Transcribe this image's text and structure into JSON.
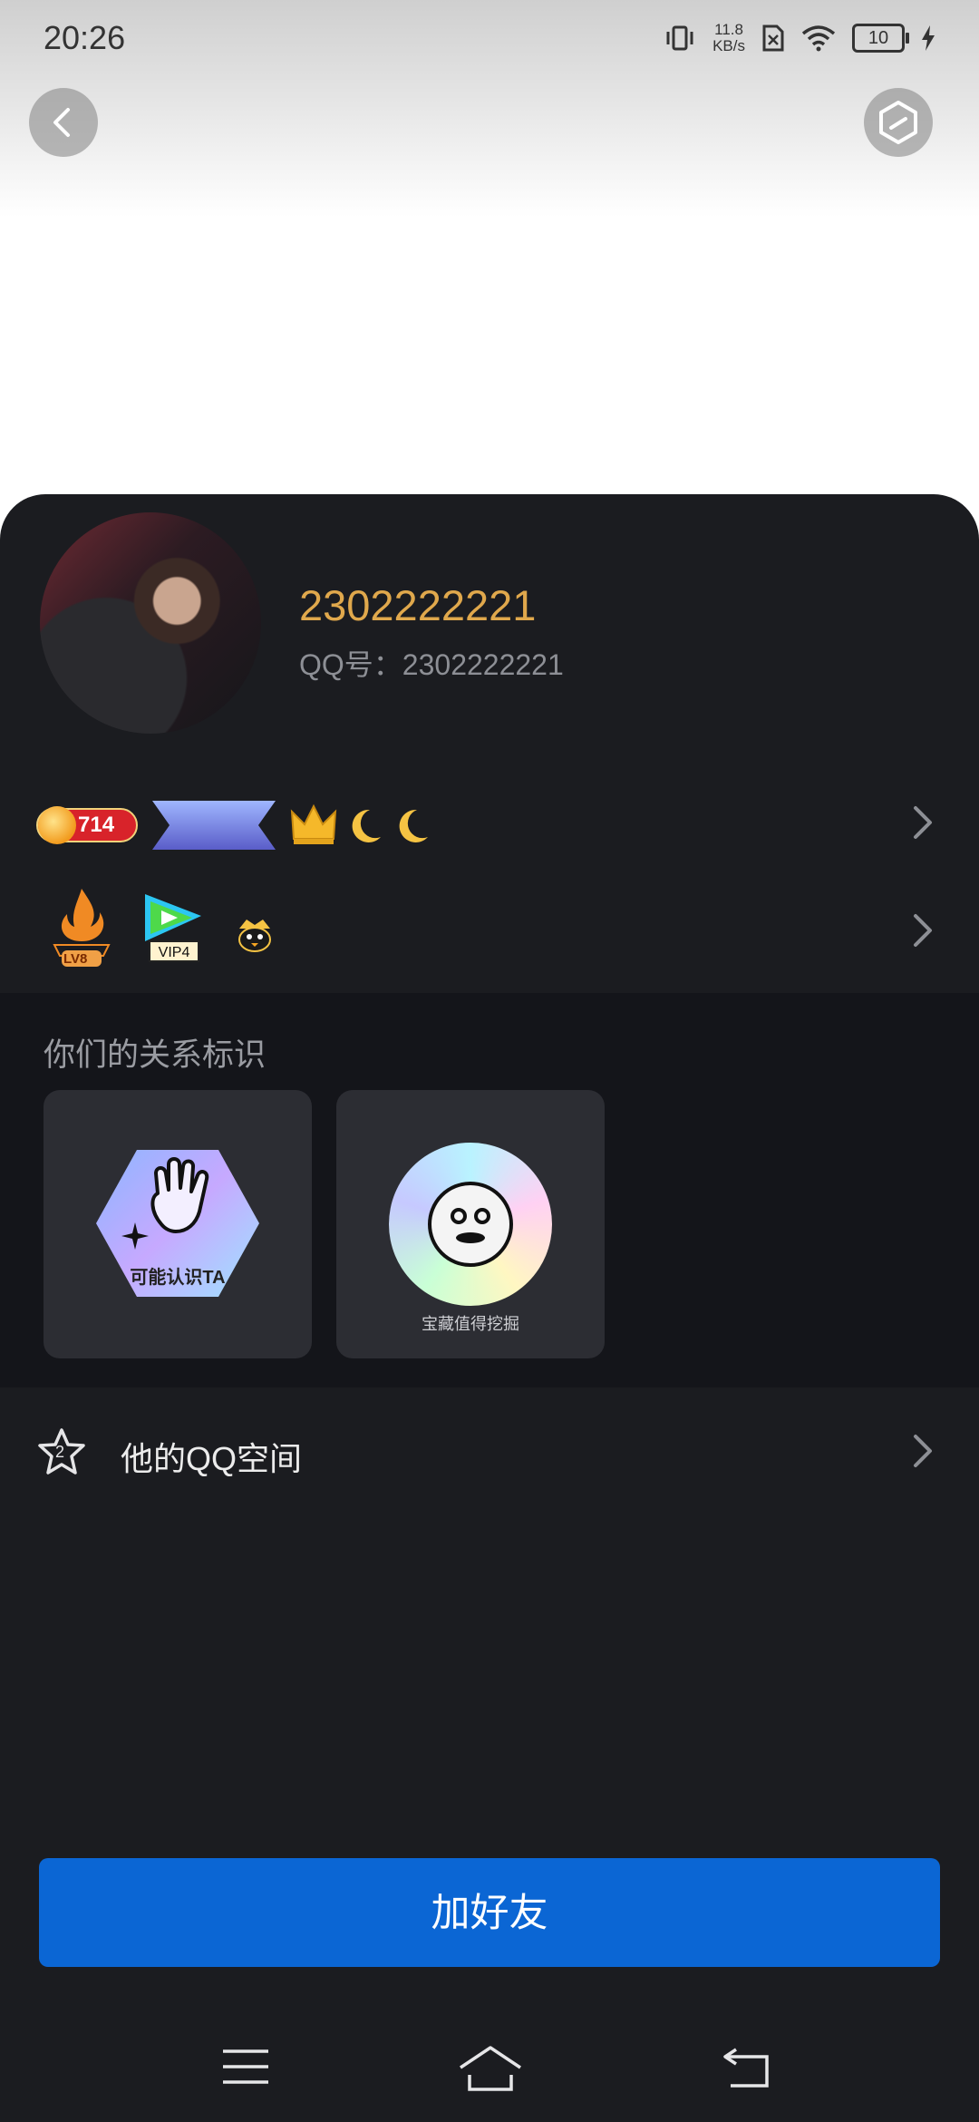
{
  "status_bar": {
    "time": "20:26",
    "net_speed_value": "11.8",
    "net_speed_unit": "KB/s",
    "battery": "10"
  },
  "profile": {
    "nickname": "2302222221",
    "qq_label": "QQ号：",
    "qq_number": "2302222221"
  },
  "badges": {
    "score": "714",
    "level_label": "LV8",
    "vip_label": "VIP4"
  },
  "relations": {
    "title": "你们的关系标识",
    "tiles": [
      {
        "label": "可能认识TA"
      },
      {
        "label": "宝藏值得挖掘"
      }
    ]
  },
  "qzone": {
    "label": "他的QQ空间",
    "star_number": "2"
  },
  "actions": {
    "add_friend": "加好友"
  },
  "icons": {
    "back": "chevron-left-icon",
    "settings": "hexagon-settings-icon",
    "menu": "menu-icon",
    "home": "home-icon",
    "return": "return-icon"
  },
  "colors": {
    "accent": "#0b66d4",
    "nickname": "#e0a84c",
    "card_bg": "#1b1c20"
  }
}
